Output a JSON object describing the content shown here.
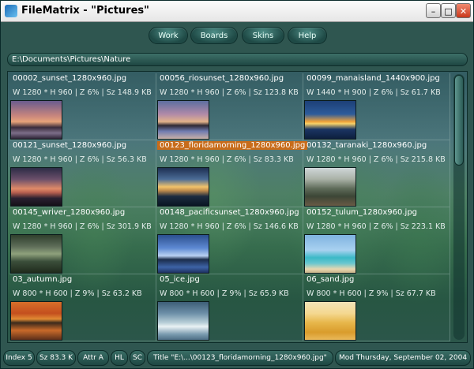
{
  "window": {
    "title": "FileMatrix - \"Pictures\"",
    "minimize": "–",
    "maximize": "□",
    "close": "✕"
  },
  "menu": [
    {
      "label": "Work"
    },
    {
      "label": "Boards"
    },
    {
      "label": "Skins"
    },
    {
      "label": "Help"
    }
  ],
  "path": "E:\\Documents\\Pictures\\Nature",
  "files": [
    {
      "name": "00002_sunset_1280x960.jpg",
      "meta": "W 1280 * H 960 | Z 6% | Sz 148.9 KB",
      "thumb": "sunset"
    },
    {
      "name": "00056_riosunset_1280x960.jpg",
      "meta": "W 1280 * H 960 | Z 6% | Sz 123.8 KB",
      "thumb": "riosunset"
    },
    {
      "name": "00099_manaisland_1440x900.jpg",
      "meta": "W 1440 * H 900 | Z 6% | Sz 61.7 KB",
      "thumb": "island"
    },
    {
      "name": "00121_sunset_1280x960.jpg",
      "meta": "W 1280 * H 960 | Z 6% | Sz 56.3 KB",
      "thumb": "sunset2"
    },
    {
      "name": "00123_floridamorning_1280x960.jpg",
      "meta": "W 1280 * H 960 | Z 6% | Sz 83.3 KB",
      "thumb": "florida",
      "selected": true
    },
    {
      "name": "00132_taranaki_1280x960.jpg",
      "meta": "W 1280 * H 960 | Z 6% | Sz 215.8 KB",
      "thumb": "taranaki"
    },
    {
      "name": "00145_wriver_1280x960.jpg",
      "meta": "W 1280 * H 960 | Z 6% | Sz 301.9 KB",
      "thumb": "river"
    },
    {
      "name": "00148_pacificsunset_1280x960.jpg",
      "meta": "W 1280 * H 960 | Z 6% | Sz 146.6 KB",
      "thumb": "pacific"
    },
    {
      "name": "00152_tulum_1280x960.jpg",
      "meta": "W 1280 * H 960 | Z 6% | Sz 223.1 KB",
      "thumb": "tulum"
    },
    {
      "name": "03_autumn.jpg",
      "meta": "W 800 * H 600 | Z 9% | Sz 63.2 KB",
      "thumb": "autumn"
    },
    {
      "name": "05_ice.jpg",
      "meta": "W 800 * H 600 | Z 9% | Sz 65.9 KB",
      "thumb": "ice"
    },
    {
      "name": "06_sand.jpg",
      "meta": "W 800 * H 600 | Z 9% | Sz 67.7 KB",
      "thumb": "sand"
    }
  ],
  "status": [
    {
      "label": "Index 5"
    },
    {
      "label": "Sz 83.3 K"
    },
    {
      "label": "Attr A"
    },
    {
      "label": "HL"
    },
    {
      "label": "SC"
    },
    {
      "label": "Title \"E:\\...\\00123_floridamorning_1280x960.jpg\""
    },
    {
      "label": "Mod Thursday, September 02, 2004"
    }
  ]
}
